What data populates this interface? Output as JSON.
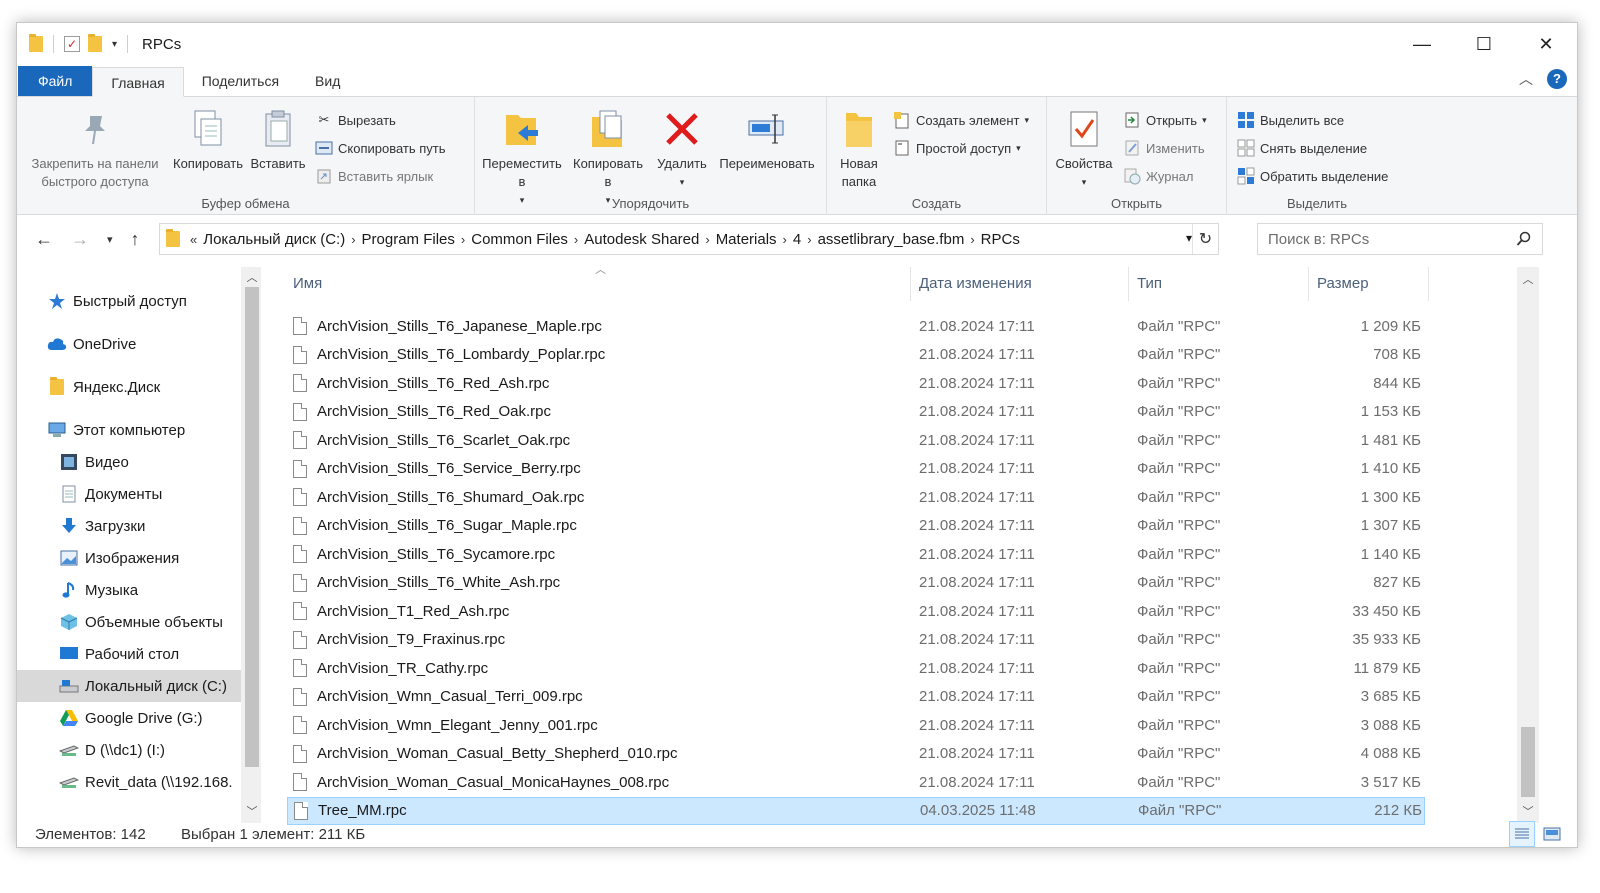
{
  "window": {
    "title": "RPCs",
    "controls": {
      "minimize": "—",
      "maximize": "☐",
      "close": "✕"
    }
  },
  "ribbon_tabs": [
    {
      "label": "Файл"
    },
    {
      "label": "Главная"
    },
    {
      "label": "Поделиться"
    },
    {
      "label": "Вид"
    }
  ],
  "ribbon": {
    "clipboard": {
      "label": "Буфер обмена",
      "pin": "Закрепить на панели быстрого доступа",
      "copy": "Копировать",
      "paste": "Вставить",
      "cut": "Вырезать",
      "copy_path": "Скопировать путь",
      "paste_shortcut": "Вставить ярлык"
    },
    "organize": {
      "label": "Упорядочить",
      "move_to": "Переместить в",
      "copy_to": "Копировать в",
      "delete": "Удалить",
      "rename": "Переименовать"
    },
    "create": {
      "label": "Создать",
      "new_folder": "Новая папка",
      "new_item": "Создать элемент",
      "easy_access": "Простой доступ"
    },
    "open": {
      "label": "Открыть",
      "properties": "Свойства",
      "open": "Открыть",
      "edit": "Изменить",
      "history": "Журнал"
    },
    "select": {
      "label": "Выделить",
      "select_all": "Выделить все",
      "select_none": "Снять выделение",
      "invert": "Обратить выделение"
    }
  },
  "address": {
    "prefix": "«",
    "crumbs": [
      "Локальный диск (C:)",
      "Program Files",
      "Common Files",
      "Autodesk Shared",
      "Materials",
      "4",
      "assetlibrary_base.fbm",
      "RPCs"
    ],
    "search_placeholder": "Поиск в: RPCs"
  },
  "nav": [
    {
      "label": "Быстрый доступ",
      "icon": "star-icon"
    },
    {
      "label": "OneDrive",
      "icon": "cloud-icon"
    },
    {
      "label": "Яндекс.Диск",
      "icon": "folder-icon"
    },
    {
      "label": "Этот компьютер",
      "icon": "computer-icon"
    },
    {
      "label": "Видео",
      "icon": "video-icon"
    },
    {
      "label": "Документы",
      "icon": "documents-icon"
    },
    {
      "label": "Загрузки",
      "icon": "download-icon"
    },
    {
      "label": "Изображения",
      "icon": "pictures-icon"
    },
    {
      "label": "Музыка",
      "icon": "music-icon"
    },
    {
      "label": "Объемные объекты",
      "icon": "3d-objects-icon"
    },
    {
      "label": "Рабочий стол",
      "icon": "desktop-icon"
    },
    {
      "label": "Локальный диск (C:)",
      "icon": "drive-icon"
    },
    {
      "label": "Google Drive (G:)",
      "icon": "google-drive-icon"
    },
    {
      "label": "D (\\\\dc1) (I:)",
      "icon": "network-drive-icon"
    },
    {
      "label": "Revit_data (\\\\192.168.",
      "icon": "network-drive-icon"
    }
  ],
  "columns": {
    "name": "Имя",
    "date": "Дата изменения",
    "type": "Тип",
    "size": "Размер"
  },
  "files": [
    {
      "name": "ArchVision_Stills_T6_Japanese_Maple.rpc",
      "date": "21.08.2024 17:11",
      "type": "Файл \"RPC\"",
      "size": "1 209 КБ"
    },
    {
      "name": "ArchVision_Stills_T6_Lombardy_Poplar.rpc",
      "date": "21.08.2024 17:11",
      "type": "Файл \"RPC\"",
      "size": "708 КБ"
    },
    {
      "name": "ArchVision_Stills_T6_Red_Ash.rpc",
      "date": "21.08.2024 17:11",
      "type": "Файл \"RPC\"",
      "size": "844 КБ"
    },
    {
      "name": "ArchVision_Stills_T6_Red_Oak.rpc",
      "date": "21.08.2024 17:11",
      "type": "Файл \"RPC\"",
      "size": "1 153 КБ"
    },
    {
      "name": "ArchVision_Stills_T6_Scarlet_Oak.rpc",
      "date": "21.08.2024 17:11",
      "type": "Файл \"RPC\"",
      "size": "1 481 КБ"
    },
    {
      "name": "ArchVision_Stills_T6_Service_Berry.rpc",
      "date": "21.08.2024 17:11",
      "type": "Файл \"RPC\"",
      "size": "1 410 КБ"
    },
    {
      "name": "ArchVision_Stills_T6_Shumard_Oak.rpc",
      "date": "21.08.2024 17:11",
      "type": "Файл \"RPC\"",
      "size": "1 300 КБ"
    },
    {
      "name": "ArchVision_Stills_T6_Sugar_Maple.rpc",
      "date": "21.08.2024 17:11",
      "type": "Файл \"RPC\"",
      "size": "1 307 КБ"
    },
    {
      "name": "ArchVision_Stills_T6_Sycamore.rpc",
      "date": "21.08.2024 17:11",
      "type": "Файл \"RPC\"",
      "size": "1 140 КБ"
    },
    {
      "name": "ArchVision_Stills_T6_White_Ash.rpc",
      "date": "21.08.2024 17:11",
      "type": "Файл \"RPC\"",
      "size": "827 КБ"
    },
    {
      "name": "ArchVision_T1_Red_Ash.rpc",
      "date": "21.08.2024 17:11",
      "type": "Файл \"RPC\"",
      "size": "33 450 КБ"
    },
    {
      "name": "ArchVision_T9_Fraxinus.rpc",
      "date": "21.08.2024 17:11",
      "type": "Файл \"RPC\"",
      "size": "35 933 КБ"
    },
    {
      "name": "ArchVision_TR_Cathy.rpc",
      "date": "21.08.2024 17:11",
      "type": "Файл \"RPC\"",
      "size": "11 879 КБ"
    },
    {
      "name": "ArchVision_Wmn_Casual_Terri_009.rpc",
      "date": "21.08.2024 17:11",
      "type": "Файл \"RPC\"",
      "size": "3 685 КБ"
    },
    {
      "name": "ArchVision_Wmn_Elegant_Jenny_001.rpc",
      "date": "21.08.2024 17:11",
      "type": "Файл \"RPC\"",
      "size": "3 088 КБ"
    },
    {
      "name": "ArchVision_Woman_Casual_Betty_Shepherd_010.rpc",
      "date": "21.08.2024 17:11",
      "type": "Файл \"RPC\"",
      "size": "4 088 КБ"
    },
    {
      "name": "ArchVision_Woman_Casual_MonicaHaynes_008.rpc",
      "date": "21.08.2024 17:11",
      "type": "Файл \"RPC\"",
      "size": "3 517 КБ"
    },
    {
      "name": "Tree_MM.rpc",
      "date": "04.03.2025 11:48",
      "type": "Файл \"RPC\"",
      "size": "212 КБ"
    }
  ],
  "status": {
    "count": "Элементов: 142",
    "selection": "Выбран 1 элемент: 211 КБ"
  },
  "colors": {
    "accent": "#1a68bc",
    "selection_bg": "#cce8ff",
    "selection_border": "#99d1ff",
    "header_text": "#4c607a"
  }
}
